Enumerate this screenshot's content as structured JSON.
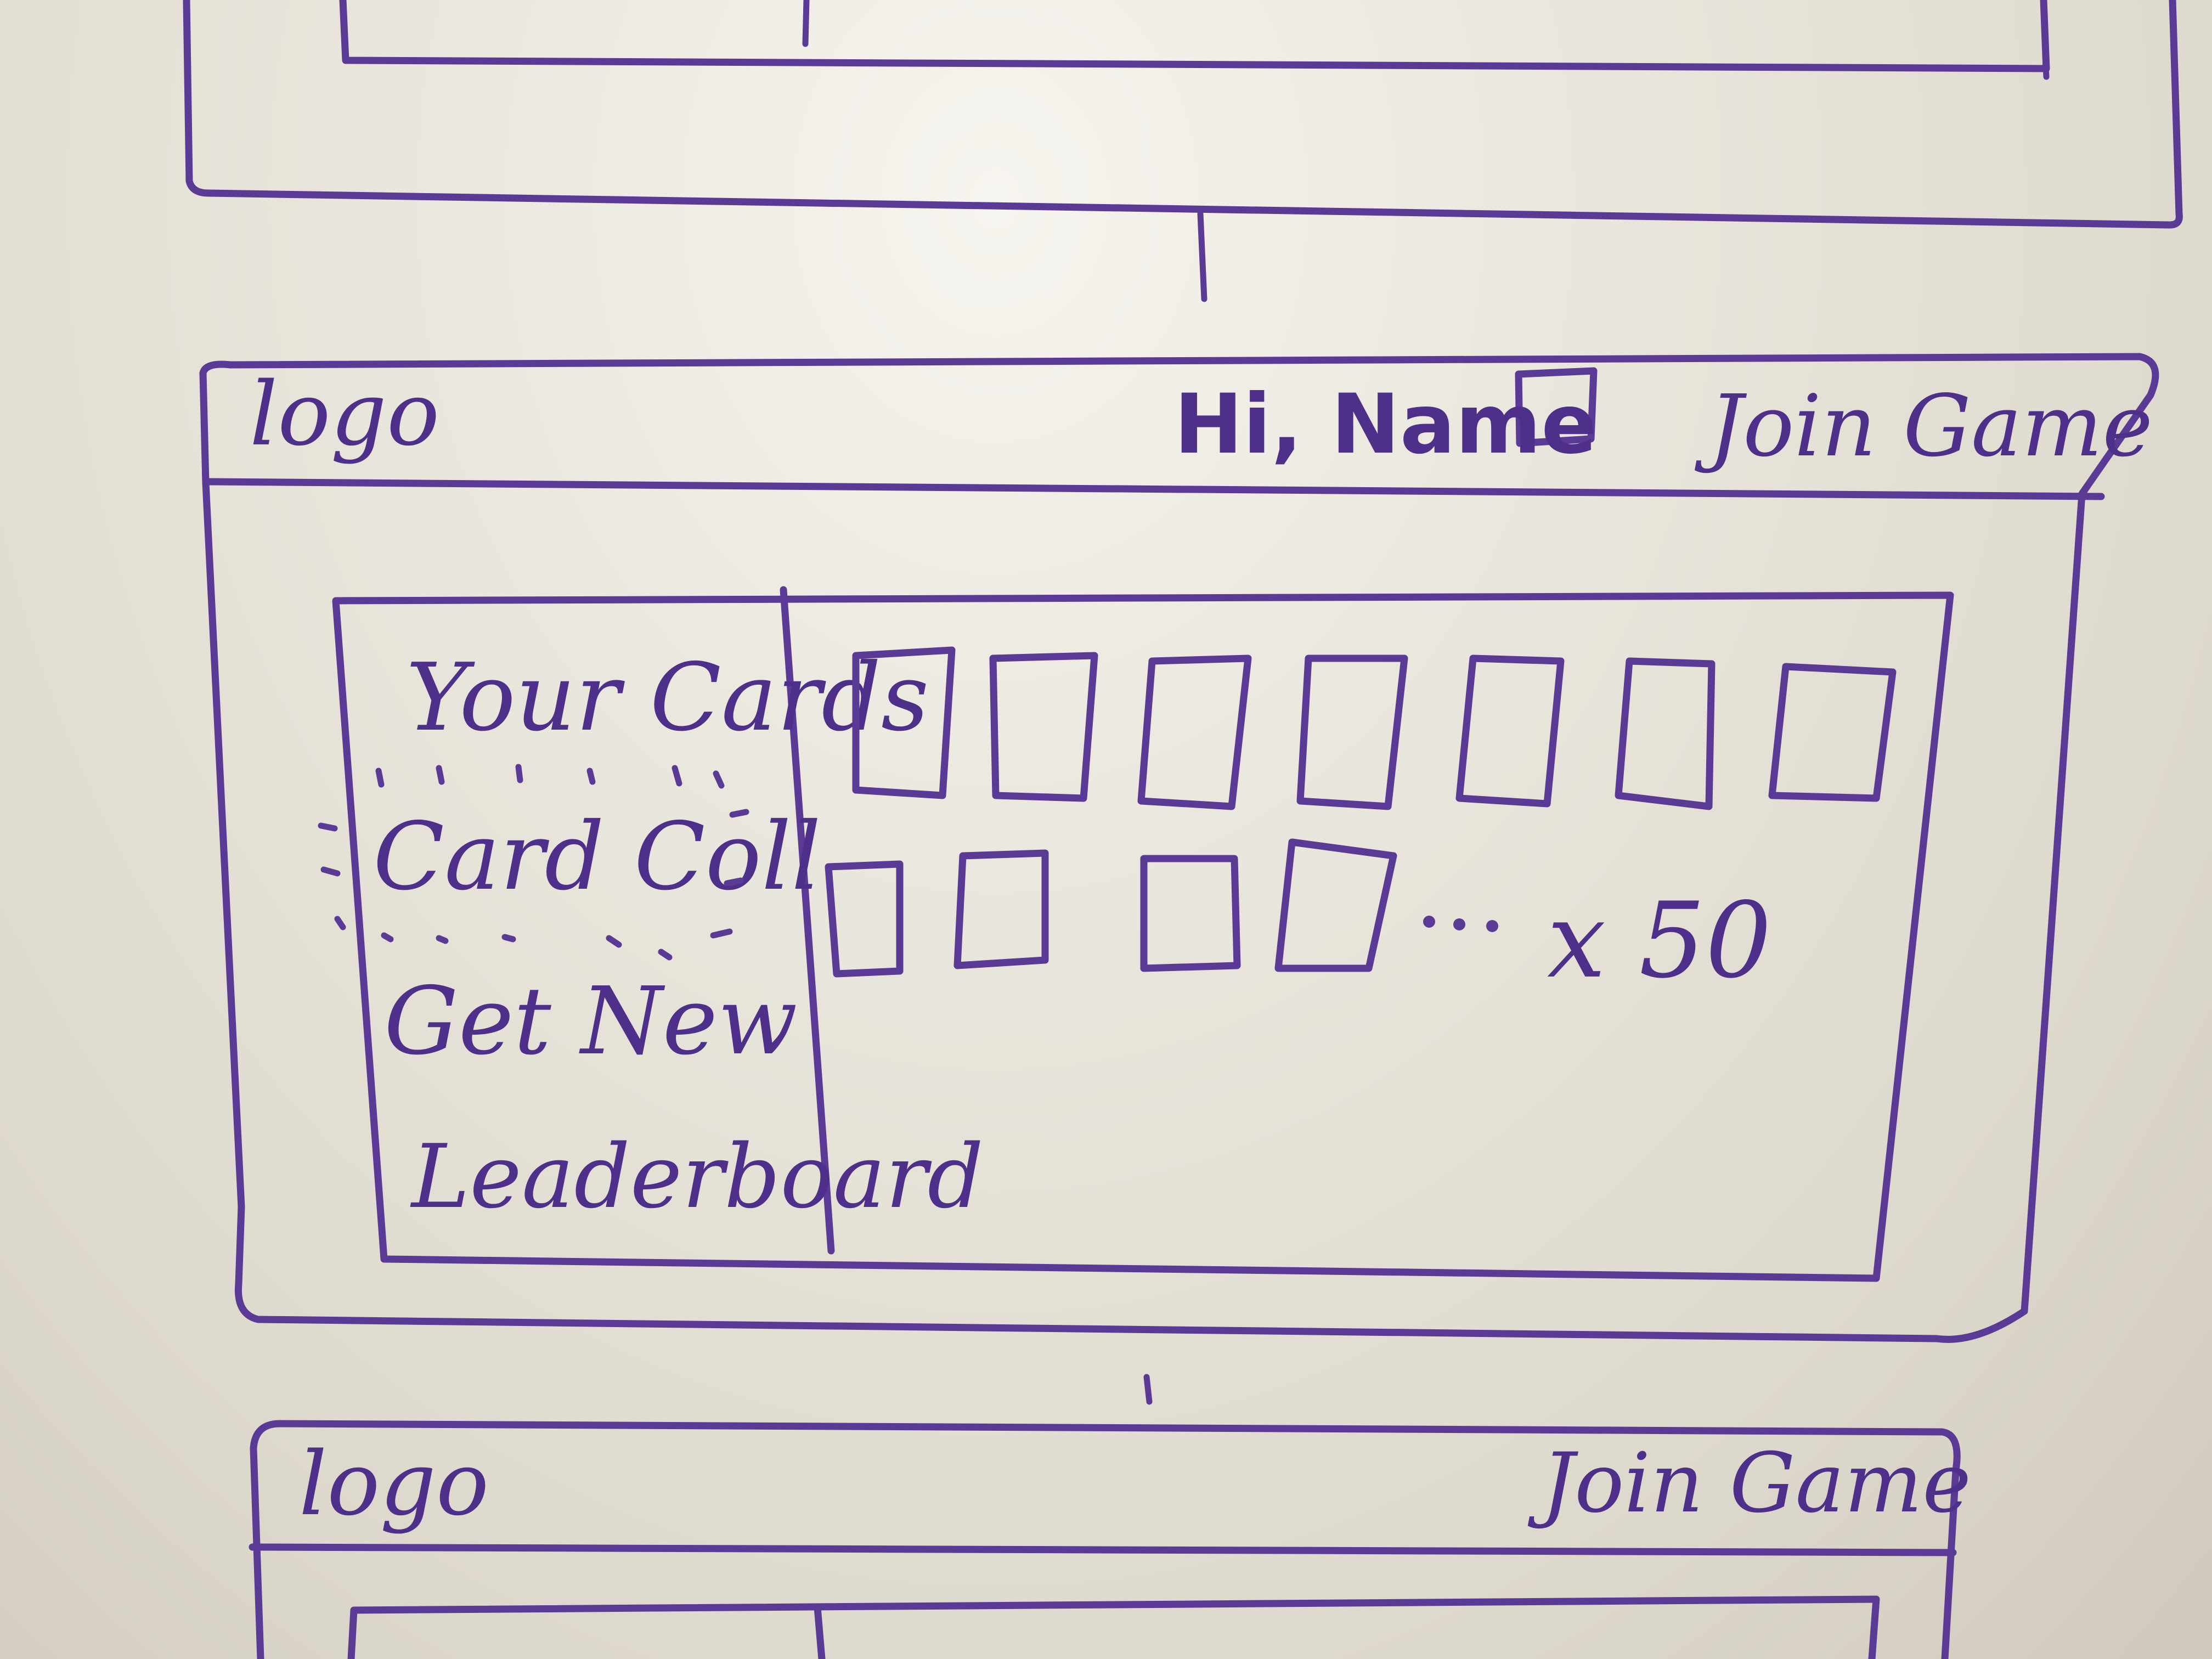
{
  "screen": {
    "header": {
      "logo_text": "logo",
      "greeting": "Hi, Name",
      "join_game": "Join Game"
    },
    "sidebar": {
      "items": [
        {
          "label": "Your Cards"
        },
        {
          "label": "Card Coll"
        },
        {
          "label": "Get New"
        },
        {
          "label": "Leaderboard"
        }
      ],
      "highlighted_index": 1
    },
    "cards": {
      "row1_count": 7,
      "row2_count": 4,
      "multiplier": "x 50"
    }
  },
  "next_screen": {
    "header": {
      "logo_text": "logo",
      "join_game": "Join Game"
    }
  },
  "colors": {
    "ink": "#5a3a95",
    "whiteboard": "#e8e4da"
  }
}
